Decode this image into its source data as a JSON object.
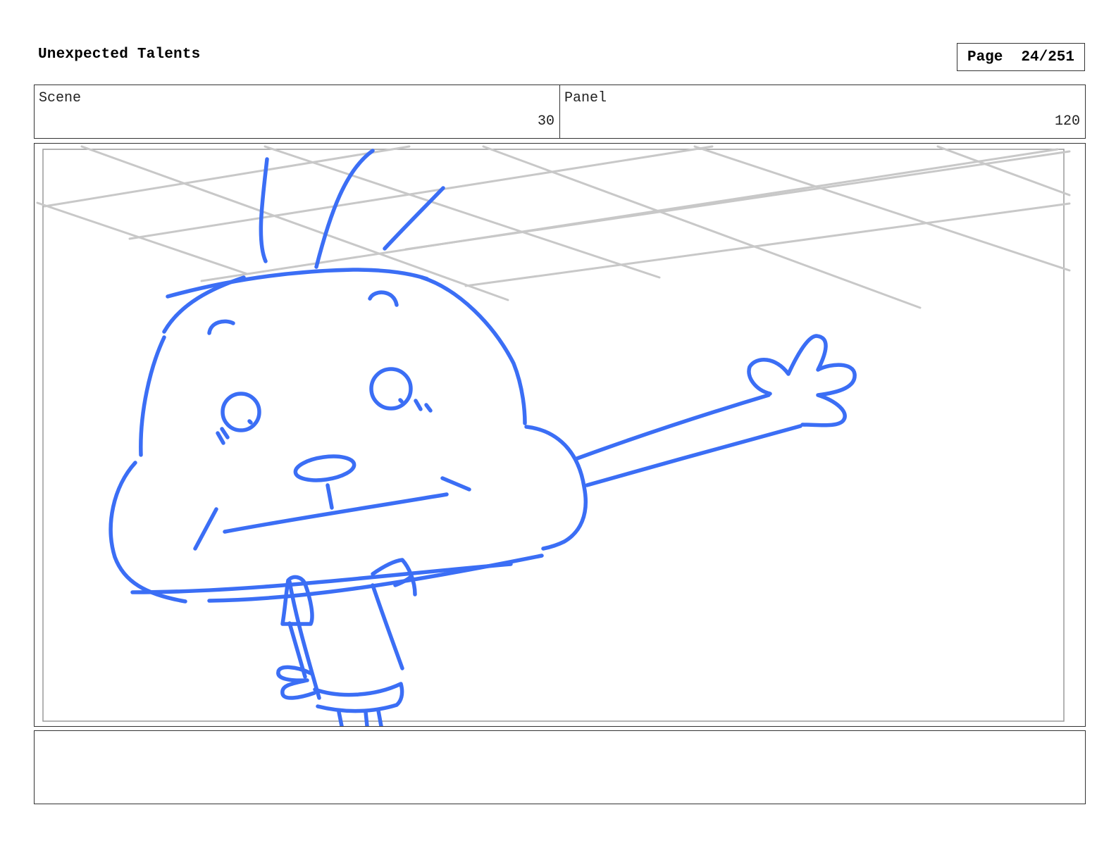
{
  "document": {
    "title": "Unexpected Talents",
    "page_label": "Page",
    "page_number": "24/251"
  },
  "info": {
    "scene_label": "Scene",
    "scene_value": "30",
    "panel_label": "Panel",
    "panel_value": "120"
  },
  "notes": {
    "text": ""
  },
  "colors": {
    "sketch": "#3b6ef5",
    "grid": "#c8c8c8",
    "border": "#333333"
  }
}
